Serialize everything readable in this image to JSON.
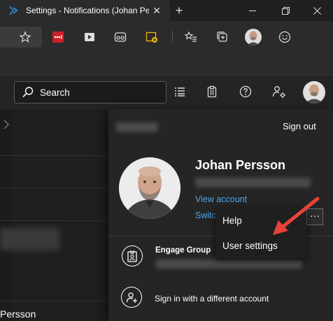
{
  "browser": {
    "tab_title": "Settings - Notifications (Johan Pe",
    "tab_close": "✕",
    "new_tab": "+",
    "window_min": "—",
    "window_restore": "❐",
    "window_close": "✕"
  },
  "toolbar": {
    "icons": [
      "star-icon",
      "lastpass-icon",
      "media-icon",
      "glasses-icon",
      "extension-new-icon",
      "favorites-icon",
      "collections-icon",
      "profile-avatar",
      "emoji-icon"
    ]
  },
  "header": {
    "search_label": "Search",
    "icons": [
      "list-icon",
      "clipboard-icon",
      "help-icon",
      "settings-person-icon",
      "avatar"
    ]
  },
  "account_panel": {
    "sign_out": "Sign out",
    "user_name": "Johan Persson",
    "view_account": "View account",
    "switch_partial": "Switc",
    "more_label": "···",
    "org_name": "Engage Group",
    "sign_in_different": "Sign in with a different account"
  },
  "context_menu": {
    "items": [
      "Help",
      "User settings"
    ]
  },
  "left_page": {
    "bottom_text": "Persson"
  },
  "colors": {
    "link": "#4ea6e8",
    "arrow": "#e8433a",
    "panel_bg": "#252525",
    "lastpass_red": "#cc2029"
  }
}
